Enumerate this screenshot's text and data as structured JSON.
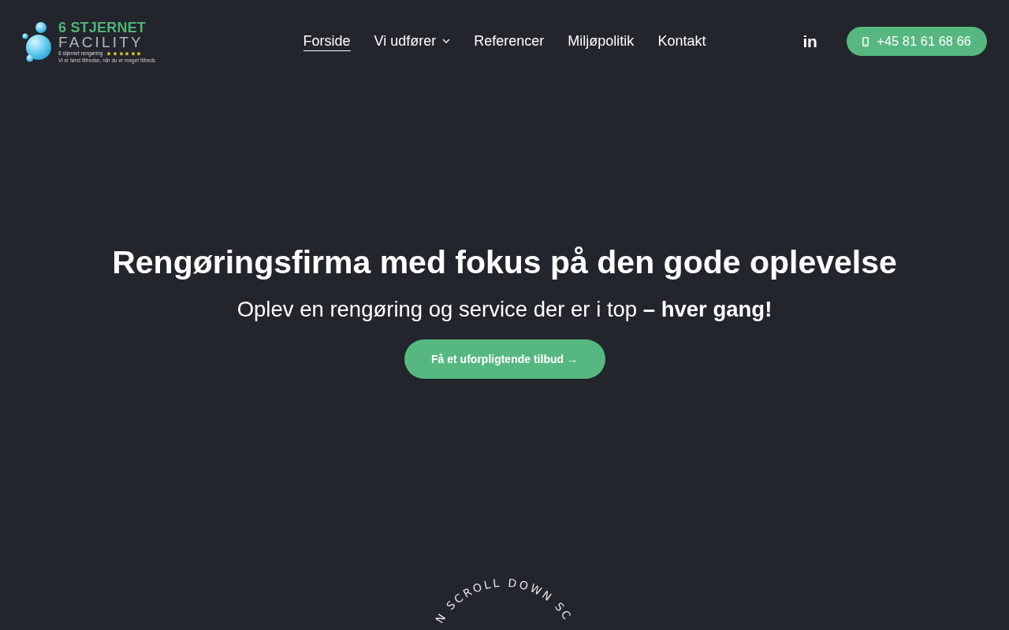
{
  "logo": {
    "name_line1": "6 STJERNET",
    "name_line2": "FACILITY",
    "subtitle": "6 stjernet rengøring",
    "stars": 6,
    "tagline": "Vi er først tilfredse, når du er meget tilfreds"
  },
  "nav": [
    {
      "label": "Forside",
      "selected": true,
      "dropdown": false
    },
    {
      "label": "Vi udfører",
      "selected": false,
      "dropdown": true
    },
    {
      "label": "Referencer",
      "selected": false,
      "dropdown": false
    },
    {
      "label": "Miljøpolitik",
      "selected": false,
      "dropdown": false
    },
    {
      "label": "Kontakt",
      "selected": false,
      "dropdown": false
    }
  ],
  "social_link": "in",
  "phone_button": "+45 81 61 68 66",
  "hero": {
    "heading": "Rengøringsfirma med fokus på den gode oplevelse",
    "subheading": "Oplev en rengøring og service der er i top **– hver gang!**",
    "cta": "Få et uforpligtende tilbud →"
  },
  "scroll_indicator": "N SCROLL DOWN SC"
}
